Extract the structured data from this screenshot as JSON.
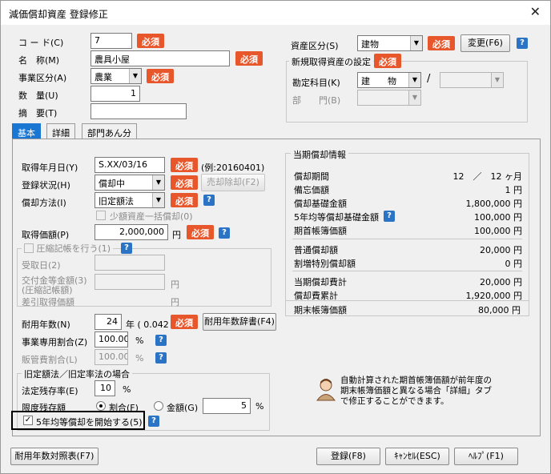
{
  "window": {
    "title": "減価償却資産 登録修正"
  },
  "hissu_label": "必須",
  "header": {
    "code_label": "コ ー ド(C)",
    "code_value": "7",
    "name_label": "名　称(M)",
    "name_value": "農具小屋",
    "jigyo_label": "事業区分(A)",
    "jigyo_value": "農業",
    "suryo_label": "数　量(U)",
    "suryo_value": "1",
    "tekiyo_label": "摘　要(T)",
    "tekiyo_value": "",
    "shisan_label": "資産区分(S)",
    "shisan_value": "建物",
    "change_button": "変更(F6)",
    "new_group_label": "新規取得資産の設定",
    "kanjo_label": "勘定科目(K)",
    "kanjo_value": "建　　物",
    "bumon_label": "部　　門(B)"
  },
  "tabs": [
    {
      "label": "基本"
    },
    {
      "label": "詳細"
    },
    {
      "label": "部門あん分"
    }
  ],
  "basic": {
    "shutoku_label": "取得年月日(Y)",
    "shutoku_value": "S.XX/03/16",
    "shutoku_example": "(例:20160401)",
    "toroku_label": "登録状況(H)",
    "toroku_value": "償却中",
    "baikyaku_button": "売却除却(F2)",
    "shokyaku_label": "償却方法(I)",
    "shokyaku_value": "旧定額法",
    "shogaku_label": "少額資産一括償却(0)",
    "kagaku_label": "取得価額(P)",
    "kagaku_value": "2,000,000",
    "yen": "円",
    "asshuku_label": "圧縮記帳を行う(1)",
    "juekibi_label": "受取日(2)",
    "kofukin_label": "交付金等金額(3)",
    "kofukin_sub": "(圧縮記帳額)",
    "sashihiki_label": "差引取得価額",
    "taiyo_label": "耐用年数(N)",
    "taiyo_value": "24",
    "taiyo_rate": "年 ( 0.042 )",
    "dictionary_button": "耐用年数辞書(F4)",
    "jigyo_wari_label": "事業専用割合(Z)",
    "jigyo_wari_value": "100.00",
    "hankan_label": "販管費割合(L)",
    "hankan_value": "100.00",
    "percent": "%",
    "old_group_label": "旧定額法／旧定率法の場合",
    "zanzon_label": "法定残存率(E)",
    "zanzon_value": "10",
    "gendo_label": "限度残存額",
    "wariai_label": "割合(F)",
    "kingaku_label": "金額(G)",
    "gendo_value": "5",
    "five_year_label": "5年均等償却を開始する(5)"
  },
  "current": {
    "group_label": "当期償却情報",
    "rows": [
      {
        "label": "償却期間",
        "value": "12　／　12 ヶ月"
      },
      {
        "label": "備忘価額",
        "value": "1 円"
      },
      {
        "label": "償却基礎金額",
        "value": "1,800,000 円"
      },
      {
        "label": "5年均等償却基礎金額",
        "value": "100,000 円"
      },
      {
        "label": "期首帳簿価額",
        "value": "100,000 円"
      },
      {
        "label": "普通償却額",
        "value": "20,000 円"
      },
      {
        "label": "割増特別償却額",
        "value": "0 円"
      },
      {
        "label": "当期償却費計",
        "value": "20,000 円"
      },
      {
        "label": "償却費累計",
        "value": "1,920,000 円"
      },
      {
        "label": "期末帳簿価額",
        "value": "80,000 円"
      }
    ]
  },
  "hint_text": "自動計算された期首帳簿価額が前年度の\n期末帳簿価額と異なる場合「詳細」タブ\nで修正することができます。",
  "footer": {
    "table_button": "耐用年数対照表(F7)",
    "save_button": "登録(F8)",
    "cancel_button": "ｷｬﾝｾﾙ(ESC)",
    "help_button": "ﾍﾙﾌﾟ(F1)"
  },
  "colors": {
    "hissu": "#e8572b",
    "help": "#2b73c4",
    "active_tab": "#1976d2"
  }
}
